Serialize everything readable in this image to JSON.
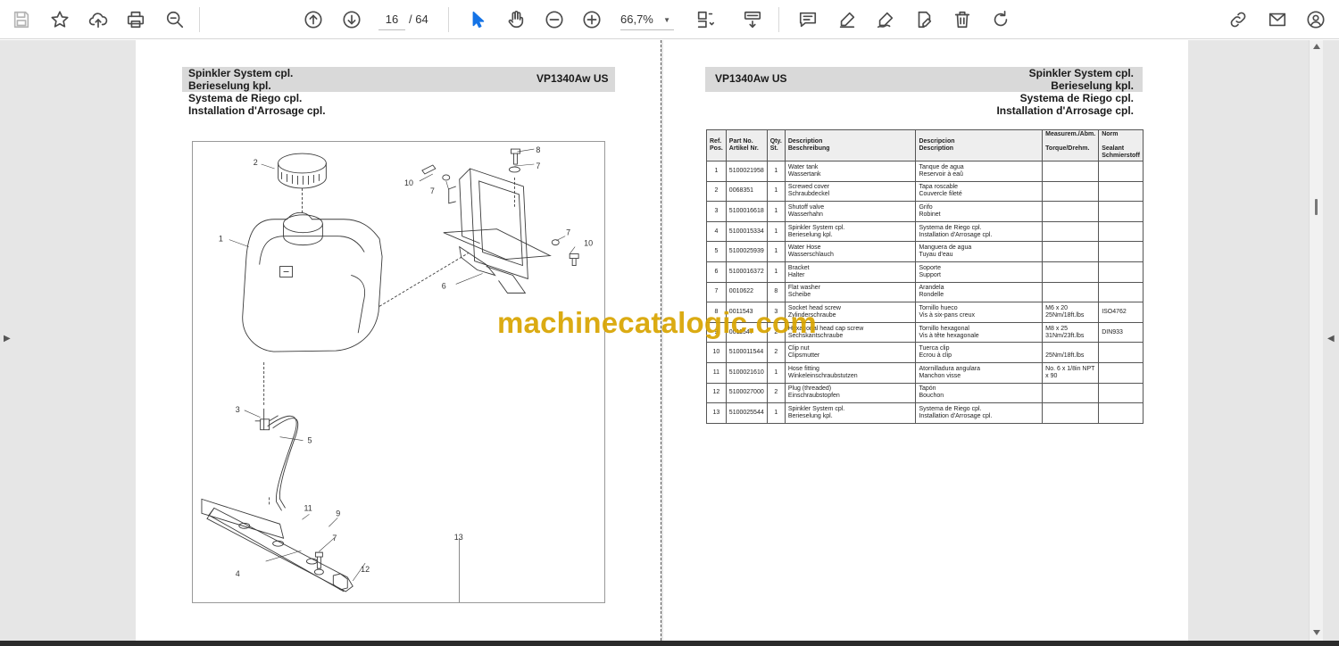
{
  "toolbar": {
    "page_current": "16",
    "page_total": "/ 64",
    "zoom": "66,7%"
  },
  "left_page": {
    "title_lines": [
      "Spinkler System cpl.",
      "Berieselung kpl.",
      "Systema de Riego cpl.",
      "Installation d'Arrosage cpl."
    ],
    "model": "VP1340Aw US",
    "callouts": [
      "1",
      "2",
      "3",
      "4",
      "5",
      "6",
      "7",
      "7",
      "7",
      "7",
      "8",
      "9",
      "10",
      "10",
      "11",
      "12",
      "13"
    ]
  },
  "right_page": {
    "model": "VP1340Aw US",
    "title_lines": [
      "Spinkler System cpl.",
      "Berieselung kpl.",
      "Systema de Riego cpl.",
      "Installation d'Arrosage cpl."
    ],
    "table": {
      "headers": {
        "ref_1": "Ref.",
        "ref_2": "Pos.",
        "part_1": "Part No.",
        "part_2": "Artikel Nr.",
        "qty_1": "Qty.",
        "qty_2": "St.",
        "desc_1": "Description",
        "desc_2": "Beschreibung",
        "desp_1": "Descripcion",
        "desp_2": "Description",
        "meas_1": "Measurem./Abm.",
        "meas_2": "Torque/Drehm.",
        "norm_1": "Norm",
        "norm_2": "Sealant",
        "norm_3": "Schmierstoff"
      },
      "rows": [
        {
          "ref": "1",
          "part": "5100021958",
          "qty": "1",
          "en": "Water tank",
          "de": "Wassertank",
          "es": "Tanque de agua",
          "fr": "Reservoir à eaû",
          "meas1": "",
          "meas2": "",
          "norm": ""
        },
        {
          "ref": "2",
          "part": "0068351",
          "qty": "1",
          "en": "Screwed cover",
          "de": "Schraubdeckel",
          "es": "Tapa roscable",
          "fr": "Couvercle fileté",
          "meas1": "",
          "meas2": "",
          "norm": ""
        },
        {
          "ref": "3",
          "part": "5100016618",
          "qty": "1",
          "en": "Shutoff valve",
          "de": "Wasserhahn",
          "es": "Grifo",
          "fr": "Robinet",
          "meas1": "",
          "meas2": "",
          "norm": ""
        },
        {
          "ref": "4",
          "part": "5100015334",
          "qty": "1",
          "en": "Spinkler System cpl.",
          "de": "Berieselung kpl.",
          "es": "Systema de Riego cpl.",
          "fr": "Installation d'Arrosage cpl.",
          "meas1": "",
          "meas2": "",
          "norm": ""
        },
        {
          "ref": "5",
          "part": "5100025939",
          "qty": "1",
          "en": "Water Hose",
          "de": "Wasserschlauch",
          "es": "Manguera de agua",
          "fr": "Tuyau d'eau",
          "meas1": "",
          "meas2": "",
          "norm": ""
        },
        {
          "ref": "6",
          "part": "5100016372",
          "qty": "1",
          "en": "Bracket",
          "de": "Halter",
          "es": "Soporte",
          "fr": "Support",
          "meas1": "",
          "meas2": "",
          "norm": ""
        },
        {
          "ref": "7",
          "part": "0010622",
          "qty": "8",
          "en": "Flat washer",
          "de": "Scheibe",
          "es": "Arandela",
          "fr": "Rondelle",
          "meas1": "",
          "meas2": "",
          "norm": ""
        },
        {
          "ref": "8",
          "part": "0011543",
          "qty": "3",
          "en": "Socket head screw",
          "de": "Zylinderschraube",
          "es": "Tornillo hueco",
          "fr": "Vis à six-pans creux",
          "meas1": "M6 x 20",
          "meas2": "25Nm/18ft.lbs",
          "norm": "ISO4762"
        },
        {
          "ref": "9",
          "part": "0011547",
          "qty": "2",
          "en": "Hexagonal head cap screw",
          "de": "Sechskantschraube",
          "es": "Tornillo hexagonal",
          "fr": "Vis à tête hexagonale",
          "meas1": "M8 x 25",
          "meas2": "31Nm/23ft.lbs",
          "norm": "DIN933"
        },
        {
          "ref": "10",
          "part": "5100011544",
          "qty": "2",
          "en": "Clip nut",
          "de": "Clipsmutter",
          "es": "Tuerca clip",
          "fr": "Ecrou à clip",
          "meas1": "",
          "meas2": "25Nm/18ft.lbs",
          "norm": ""
        },
        {
          "ref": "11",
          "part": "5100021610",
          "qty": "1",
          "en": "Hose fitting",
          "de": "Winkeleinschraubstutzen",
          "es": "Atornilladura angulara",
          "fr": "Manchon visse",
          "meas1": "No. 6 x 1/8in NPT",
          "meas2": "x 90",
          "norm": ""
        },
        {
          "ref": "12",
          "part": "5100027000",
          "qty": "2",
          "en": "Plug (threaded)",
          "de": "Einschraubstopfen",
          "es": "Tapón",
          "fr": "Bouchon",
          "meas1": "",
          "meas2": "",
          "norm": ""
        },
        {
          "ref": "13",
          "part": "5100025544",
          "qty": "1",
          "en": "Spinkler System cpl.",
          "de": "Berieselung kpl.",
          "es": "Systema de Riego cpl.",
          "fr": "Installation d'Arrosage cpl.",
          "meas1": "",
          "meas2": "",
          "norm": ""
        }
      ]
    }
  },
  "watermark": "machinecatalogic.com"
}
